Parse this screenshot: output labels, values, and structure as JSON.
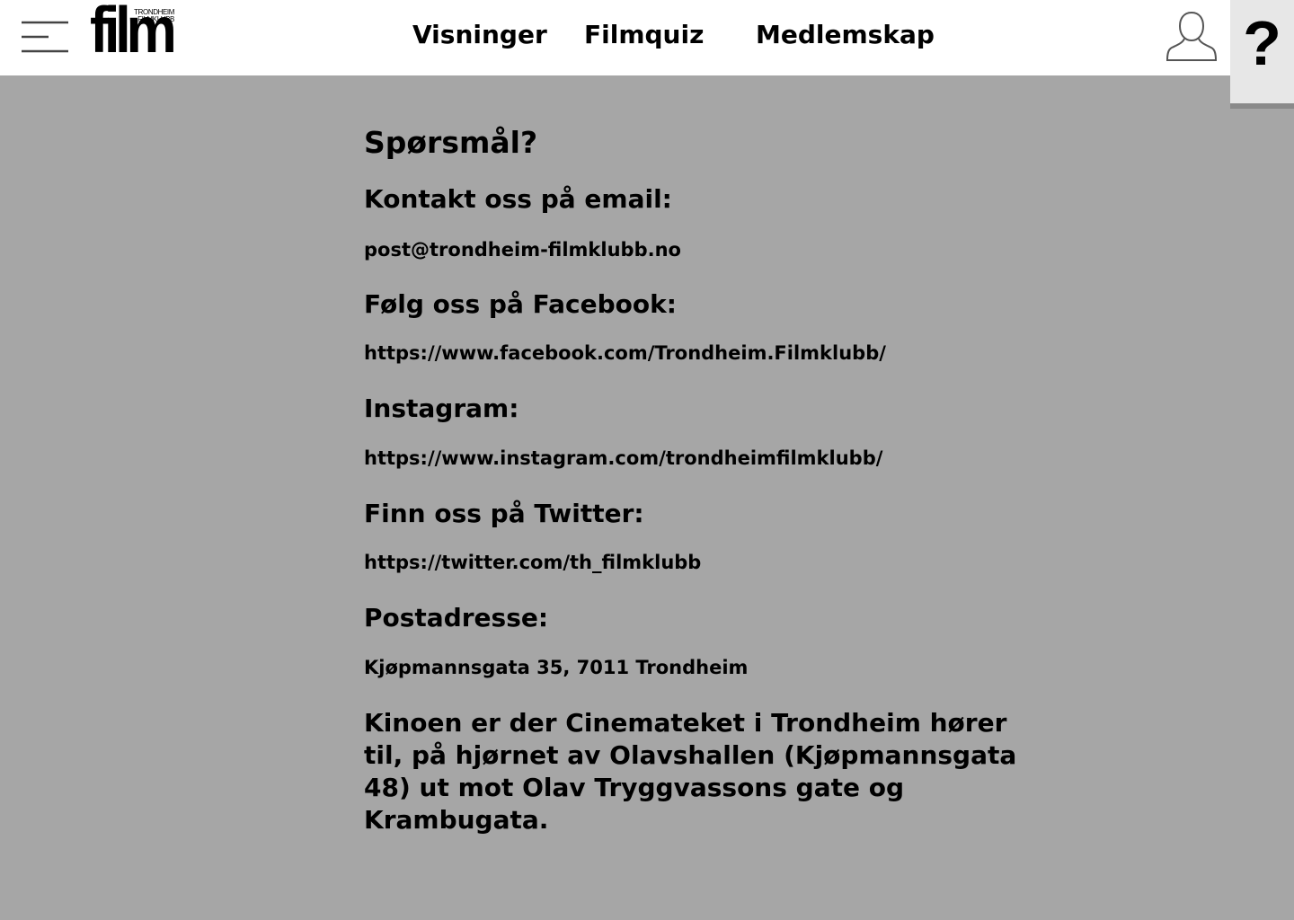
{
  "header": {
    "logo": {
      "word": "film",
      "line1": "TRONDHEIM",
      "line2": "FILMKLUBB"
    },
    "menu_icon": "hamburger-menu-icon",
    "nav": [
      {
        "label": "Visninger"
      },
      {
        "label": "Filmquiz"
      },
      {
        "label": "Medlemskap"
      }
    ],
    "user_icon": "user-icon",
    "help_label": "?"
  },
  "main": {
    "title": "Spørsmål?",
    "sections": [
      {
        "heading": "Kontakt oss på email:",
        "value": "post@trondheim-filmklubb.no"
      },
      {
        "heading": "Følg oss på Facebook:",
        "value": "https://www.facebook.com/Trondheim.Filmklubb/"
      },
      {
        "heading": "Instagram:",
        "value": "https://www.instagram.com/trondheimfilmklubb/"
      },
      {
        "heading": "Finn oss på Twitter:",
        "value": "https://twitter.com/th_filmklubb"
      },
      {
        "heading": "Postadresse:",
        "value": "Kjøpmannsgata 35, 7011 Trondheim"
      }
    ],
    "location_note": "Kinoen er der Cinemateket i Trondheim hører til, på hjørnet av Olavshallen (Kjøpmannsgata 48) ut mot Olav Tryggvassons gate og Krambugata."
  },
  "colors": {
    "background": "#a6a6a6",
    "header": "#ffffff",
    "help_box": "#e7e7e7",
    "text": "#000000"
  }
}
